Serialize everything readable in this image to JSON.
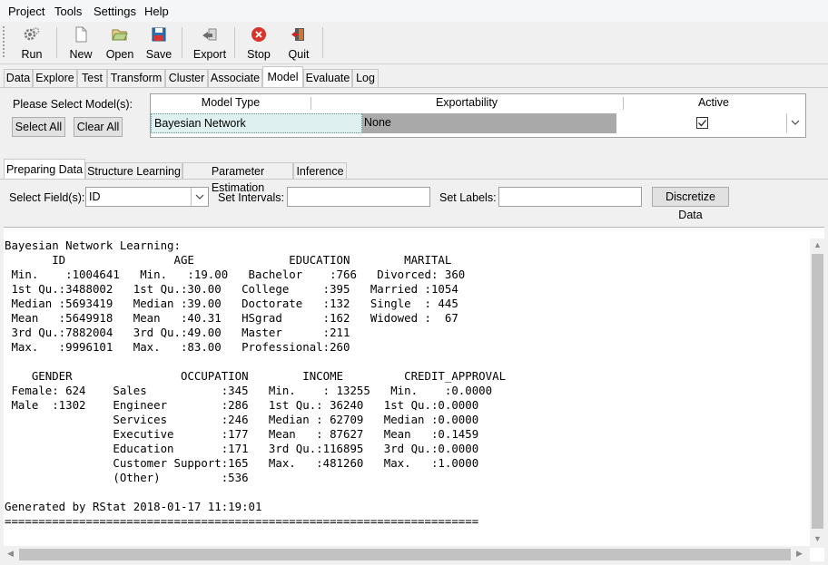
{
  "menu": [
    "Project",
    "Tools",
    "Settings",
    "Help"
  ],
  "toolbar": {
    "run": "Run",
    "new": "New",
    "open": "Open",
    "save": "Save",
    "export": "Export",
    "stop": "Stop",
    "quit": "Quit"
  },
  "tabs": [
    "Data",
    "Explore",
    "Test",
    "Transform",
    "Cluster",
    "Associate",
    "Model",
    "Evaluate",
    "Log"
  ],
  "active_tab": "Model",
  "model_panel": {
    "prompt": "Please Select Model(s):",
    "select_all": "Select All",
    "clear_all": "Clear All",
    "columns": [
      "Model Type",
      "Exportability",
      "Active"
    ],
    "row": {
      "model_type": "Bayesian Network",
      "exportability": "None",
      "active": true
    }
  },
  "sub_tabs": [
    "Preparing Data",
    "Structure Learning",
    "Parameter Estimation",
    "Inference"
  ],
  "active_sub_tab": "Preparing Data",
  "fields": {
    "select_fields_label": "Select Field(s):",
    "select_fields_value": "ID",
    "set_intervals_label": "Set Intervals:",
    "set_intervals_value": "",
    "set_labels_label": "Set Labels:",
    "set_labels_value": "",
    "discretize_button": "Discretize Data"
  },
  "output": {
    "lines": [
      "Bayesian Network Learning:",
      "       ID                AGE              EDUCATION        MARITAL",
      " Min.    :1004641   Min.   :19.00   Bachelor    :766   Divorced: 360",
      " 1st Qu.:3488002   1st Qu.:30.00   College     :395   Married :1054",
      " Median :5693419   Median :39.00   Doctorate   :132   Single  : 445",
      " Mean   :5649918   Mean   :40.31   HSgrad      :162   Widowed :  67",
      " 3rd Qu.:7882004   3rd Qu.:49.00   Master      :211",
      " Max.   :9996101   Max.   :83.00   Professional:260",
      "",
      "    GENDER                OCCUPATION        INCOME         CREDIT_APPROVAL",
      " Female: 624    Sales           :345   Min.    : 13255   Min.    :0.0000",
      " Male  :1302    Engineer        :286   1st Qu.: 36240   1st Qu.:0.0000",
      "                Services        :246   Median : 62709   Median :0.0000",
      "                Executive       :177   Mean   : 87627   Mean   :0.1459",
      "                Education       :171   3rd Qu.:116895   3rd Qu.:0.0000",
      "                Customer Support:165   Max.   :481260   Max.   :1.0000",
      "                (Other)         :536",
      "",
      "Generated by RStat 2018-01-17 11:19:01",
      "======================================================================"
    ]
  },
  "icons": {
    "run": "gear-icon",
    "new": "new-file-icon",
    "open": "folder-open-icon",
    "save": "save-icon",
    "export": "export-icon",
    "stop": "stop-icon",
    "quit": "quit-icon",
    "checkbox": "checkbox-checked-icon"
  },
  "colors": {
    "stop_red": "#d9342b",
    "selected_row": "#dff0f0",
    "grey_cell": "#a9a9a9"
  }
}
